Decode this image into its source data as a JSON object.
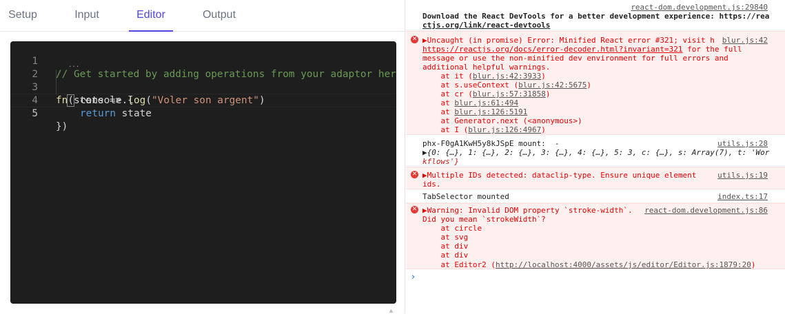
{
  "tabs": [
    "Setup",
    "Input",
    "Editor",
    "Output"
  ],
  "editor": {
    "line_numbers": [
      "1",
      "2",
      "3",
      "4",
      "5"
    ],
    "comment": "// Get started by adding operations from your adaptor here",
    "line2": {
      "fn": "fn",
      "open_paren": "(",
      "dots": "...",
      "args": "state => {"
    },
    "line3": {
      "console": "console",
      "dot": ".",
      "log": "log",
      "paren_open": "(",
      "string": "\"Voler son argent\"",
      "paren_close": ")"
    },
    "line4": {
      "kw": "return",
      "value": " state"
    },
    "line5": "})",
    "fold_icon": "chevron-down-icon"
  },
  "console": {
    "entry1": {
      "source": "react-dom.development.js:29840",
      "line1": "Download the React DevTools for a better development experience: https://rea",
      "line2": "ctjs.org/link/react-devtools"
    },
    "entry2": {
      "source": "blur.js:42",
      "line1": "▶Uncaught (in promise) Error: Minified React error #321; visit h",
      "line2_link": "https://reactjs.org/docs/error-decoder.html?invariant=321",
      "line2_rest": " for the full",
      "line3": "message or use the non-minified dev environment for full errors and",
      "line4": "additional helpful warnings.",
      "stack": [
        {
          "pre": "    at it (",
          "link": "blur.js:42:3933",
          "post": ")"
        },
        {
          "pre": "    at s.useContext (",
          "link": "blur.js:42:5675",
          "post": ")"
        },
        {
          "pre": "    at cr (",
          "link": "blur.js:57:31858",
          "post": ")"
        },
        {
          "pre": "    at ",
          "link": "blur.js:61:494",
          "post": ""
        },
        {
          "pre": "    at ",
          "link": "blur.js:126:5191",
          "post": ""
        },
        {
          "pre": "    at Generator.next (<anonymous>)",
          "link": "",
          "post": ""
        },
        {
          "pre": "    at I (",
          "link": "blur.js:126:4967",
          "post": ")"
        }
      ]
    },
    "entry3": {
      "source": "utils.js:28",
      "line1": "phx-F0gA1KwH5y8kJSpE mount:  -",
      "line2": "▶{0: {…}, 1: {…}, 2: {…}, 3: {…}, 4: {…}, 5: 3, c: {…}, s: Array(7), t: 'Wor",
      "line3": "kflows'}"
    },
    "entry4": {
      "source": "utils.js:19",
      "line1": "▶Multiple IDs detected: dataclip-type. Ensure unique element",
      "line2": "ids."
    },
    "entry5": {
      "source": "index.ts:17",
      "line1": "TabSelector mounted"
    },
    "entry6": {
      "source": "react-dom.development.js:86",
      "line1": "▶Warning: Invalid DOM property `stroke-width`.",
      "line2": "Did you mean `strokeWidth`?",
      "stack": [
        "    at circle",
        "    at svg",
        "    at div",
        "    at div"
      ],
      "last_pre": "    at Editor2 (",
      "last_link": "http://localhost:4000/assets/js/editor/Editor.js:1879:20",
      "last_post": ")"
    },
    "prompt": "›"
  },
  "colors": {
    "accent": "#4f46e5",
    "error": "#ee0000",
    "editor_bg": "#1e1e1e"
  }
}
